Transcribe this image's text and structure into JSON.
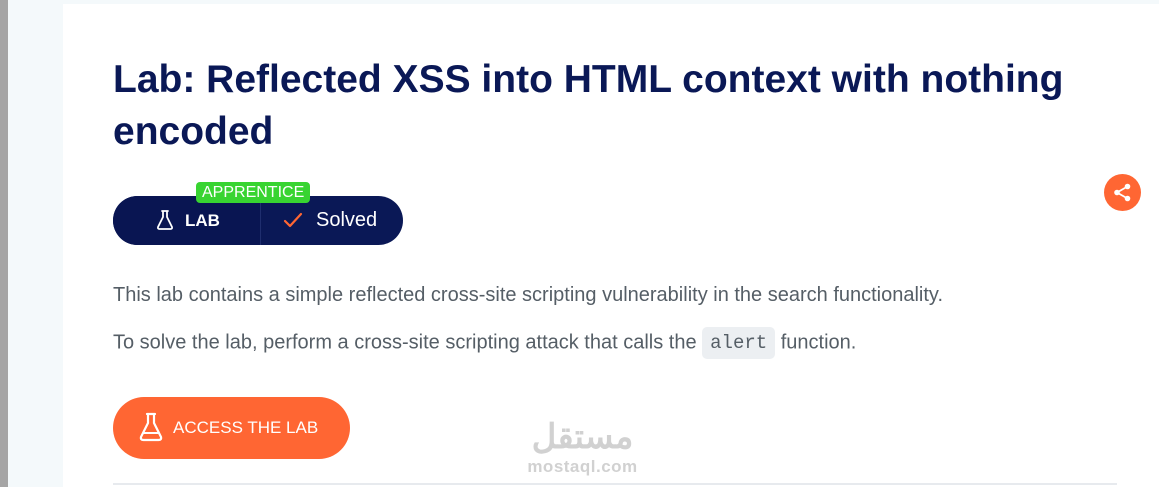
{
  "lab": {
    "title": "Lab: Reflected XSS into HTML context with nothing encoded",
    "level": "APPRENTICE",
    "tag_label": "LAB",
    "status": "Solved",
    "description": "This lab contains a simple reflected cross-site scripting vulnerability in the search functionality.",
    "instruction_before": "To solve the lab, perform a cross-site scripting attack that calls the",
    "instruction_code": "alert",
    "instruction_after": "function.",
    "access_button": "ACCESS THE LAB"
  },
  "watermark": {
    "arabic": "مستقل",
    "latin": "mostaql.com"
  },
  "colors": {
    "accent": "#ff6633",
    "navy": "#0a1856",
    "level_green": "#38d431",
    "text_gray": "#555e66"
  },
  "icons": {
    "lab": "flask-icon",
    "status": "check-icon",
    "share": "share-icon",
    "access": "flask-icon"
  }
}
